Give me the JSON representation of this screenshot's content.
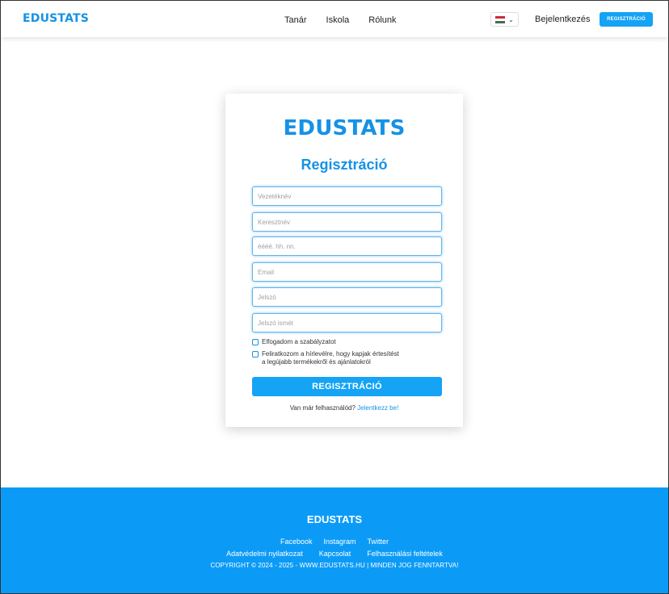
{
  "header": {
    "logo": "EDUSTATS",
    "nav": [
      "Tanár",
      "Iskola",
      "Rólunk"
    ],
    "language_flag": "hungary-flag",
    "login_label": "Bejelentkezés",
    "register_label": "REGISZTRÁCIÓ"
  },
  "card": {
    "logo": "EDUSTATS",
    "title": "Regisztráció",
    "fields": {
      "lastname_placeholder": "Vezetéknév",
      "firstname_placeholder": "Keresztnév",
      "birthdate_placeholder": "éééé. hh. nn.",
      "email_placeholder": "Email",
      "password_placeholder": "Jelszó",
      "password_confirm_placeholder": "Jelszó ismét"
    },
    "accept_terms_label": "Elfogadom a szabályzatot",
    "newsletter_line1": "Feliratkozom a hírlevélre, hogy kapjak értesítést",
    "newsletter_line2": "a legújabb termékekről és ajánlatokról",
    "submit_label": "REGISZTRÁCIÓ",
    "have_account_text": "Van már felhasználód?",
    "login_link": "Jelentkezz be!"
  },
  "footer": {
    "logo": "EDUSTATS",
    "social": [
      "Facebook",
      "Instagram",
      "Twitter"
    ],
    "links": [
      "Adatvédelmi nyilatkozat",
      "Kapcsolat",
      "Felhasználási feltételek"
    ],
    "copyright": "COPYRIGHT © 2024 - 2025 - WWW.EDUSTATS.HU | MINDEN JOG FENNTARTVA!"
  },
  "colors": {
    "brand": "#1592e6",
    "button": "#14a3f5",
    "footer_bg": "#0b9bf7"
  }
}
